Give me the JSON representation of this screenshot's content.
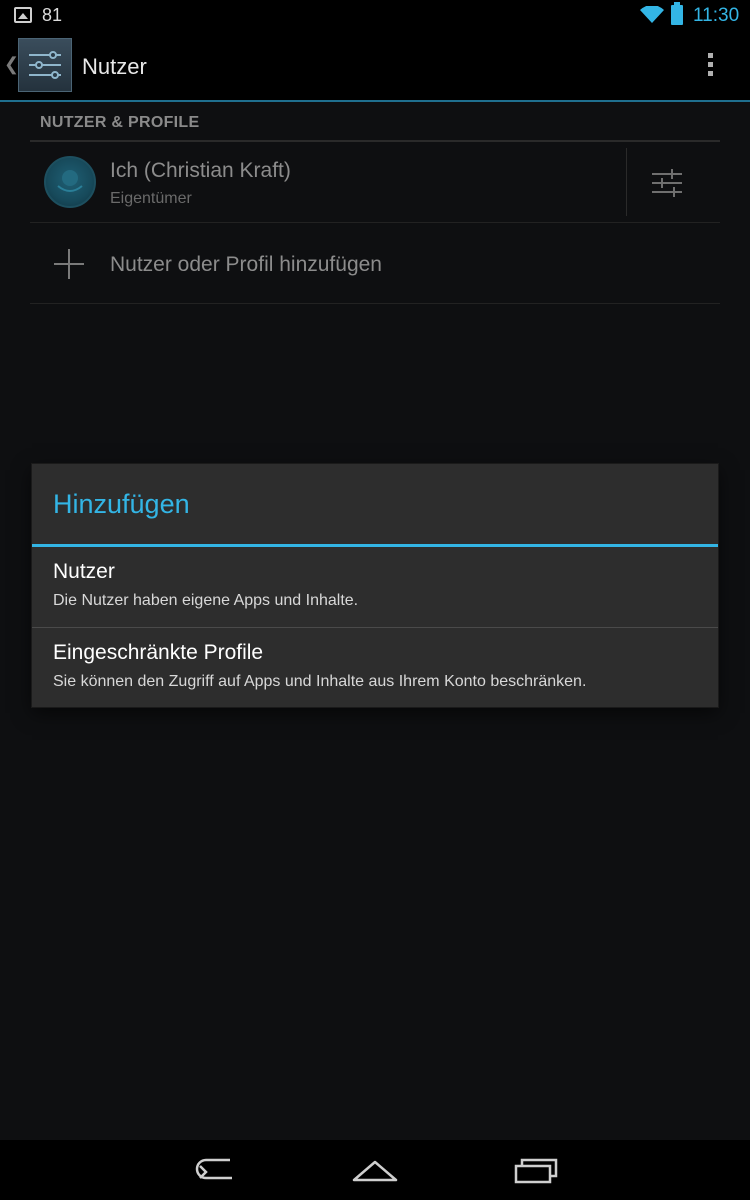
{
  "status_bar": {
    "notification_count": "81",
    "time": "11:30",
    "icons": [
      "image-icon",
      "wifi-icon",
      "battery-icon"
    ]
  },
  "action_bar": {
    "title": "Nutzer",
    "app_icon": "settings-sliders-icon",
    "overflow_icon": "overflow-menu-icon"
  },
  "section": {
    "header": "NUTZER & PROFILE"
  },
  "users": [
    {
      "name": "Ich (Christian Kraft)",
      "role": "Eigentümer"
    }
  ],
  "add_user": {
    "label": "Nutzer oder Profil hinzufügen"
  },
  "dialog": {
    "title": "Hinzufügen",
    "options": [
      {
        "title": "Nutzer",
        "description": "Die Nutzer haben eigene Apps und Inhalte."
      },
      {
        "title": "Eingeschränkte Profile",
        "description": "Sie können den Zugriff auf Apps und Inhalte aus Ihrem Konto beschränken."
      }
    ]
  },
  "nav_bar": {
    "icons": [
      "back-icon",
      "home-icon",
      "recent-apps-icon"
    ]
  },
  "colors": {
    "accent": "#33b5e5",
    "background": "#0e0f11",
    "dialog_background": "#2d2d2d"
  }
}
